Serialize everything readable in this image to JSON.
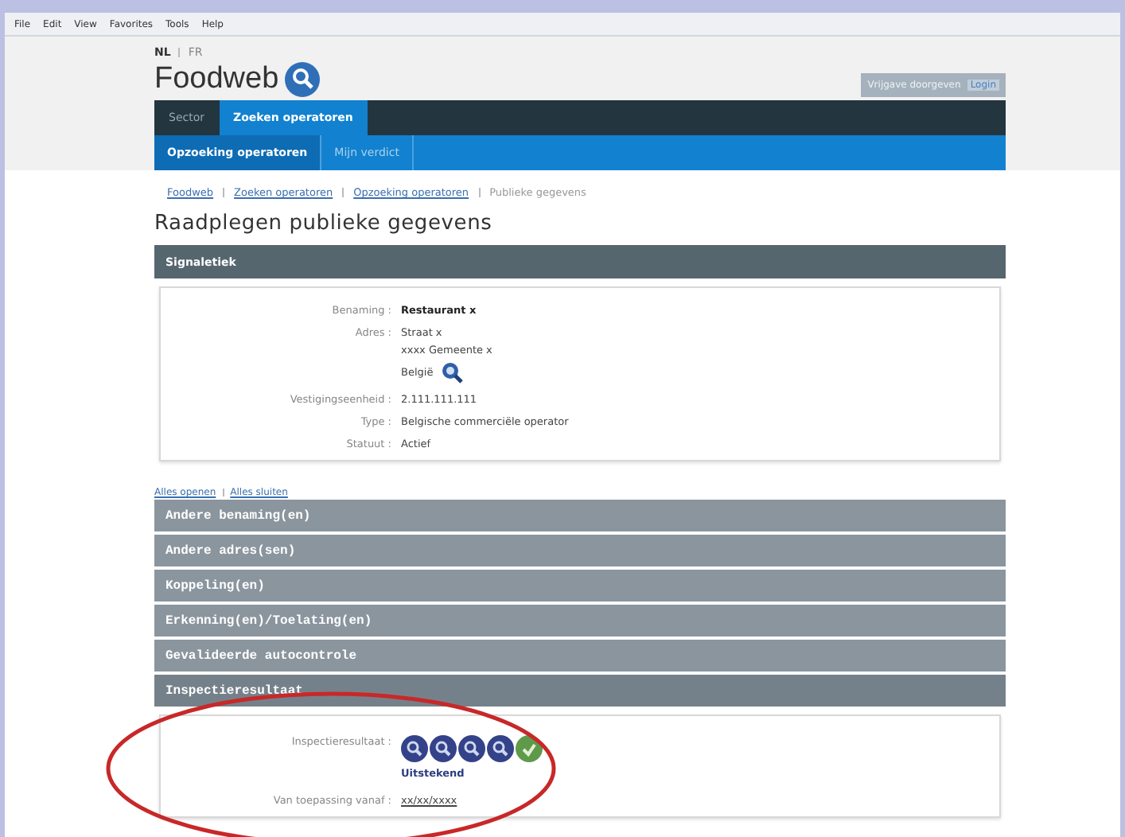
{
  "menu_bar": [
    "File",
    "Edit",
    "View",
    "Favorites",
    "Tools",
    "Help"
  ],
  "languages": [
    {
      "label": "NL",
      "selected": true
    },
    {
      "label": "FR",
      "selected": false
    }
  ],
  "logo": {
    "text": "Foodweb"
  },
  "login_button": {
    "label": "Vrijgave doorgeven",
    "link": "Login"
  },
  "main_tabs": [
    {
      "label": "Sector",
      "selected": false
    },
    {
      "label": "Zoeken operatoren",
      "selected": true
    }
  ],
  "sub_tabs": [
    {
      "label": "Opzoeking operatoren",
      "selected": true
    },
    {
      "label": "Mijn verdict",
      "selected": false
    }
  ],
  "breadcrumb": [
    "Foodweb",
    "Zoeken operatoren",
    "Opzoeking operatoren",
    "Publieke gegevens"
  ],
  "title": "Raadplegen publieke gegevens",
  "signaletiek": {
    "header": "Signaletiek",
    "fields": [
      {
        "label": "Benaming :",
        "lines": [
          "Restaurant x"
        ],
        "kind": "bold"
      },
      {
        "label": "Adres :",
        "lines": [
          "Straat x",
          "xxxx Gemeente x",
          "België"
        ],
        "kind": "map"
      },
      {
        "label": "Vestigingseenheid :",
        "lines": [
          "2.111.111.111"
        ],
        "kind": "plain"
      },
      {
        "label": "Type :",
        "lines": [
          "Belgische commerciële operator"
        ],
        "kind": "plain"
      },
      {
        "label": "Statuut :",
        "lines": [
          "Actief"
        ],
        "kind": "plain"
      }
    ]
  },
  "toggle_links": [
    "Alles openen",
    "Alles sluiten"
  ],
  "sections": [
    {
      "header": "Andere benaming(en)",
      "expanded": false
    },
    {
      "header": "Andere adres(sen)",
      "expanded": false
    },
    {
      "header": "Koppeling(en)",
      "expanded": false
    },
    {
      "header": "Erkenning(en)/Toelating(en)",
      "expanded": false
    },
    {
      "header": "Gevalideerde autocontrole",
      "expanded": false
    },
    {
      "header": "Inspectieresultaat",
      "expanded": true,
      "rating_label": "Inspectieresultaat :",
      "rating_icons": [
        {
          "kind": "blue"
        },
        {
          "kind": "blue"
        },
        {
          "kind": "blue"
        },
        {
          "kind": "blue"
        },
        {
          "kind": "green"
        }
      ],
      "rating_text": "Uitstekend",
      "date_label": "Van toepassing vanaf :",
      "date": "xx/xx/xxxx"
    }
  ]
}
